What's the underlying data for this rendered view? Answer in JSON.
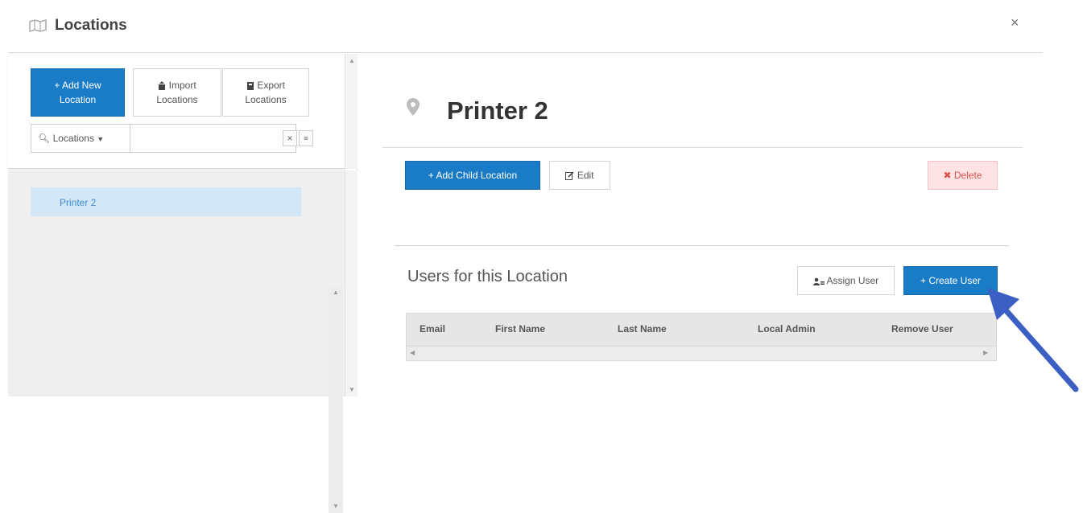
{
  "header": {
    "title": "Locations",
    "close_symbol": "×",
    "icon": "map-icon"
  },
  "left": {
    "add_new_label_1": "+ Add New",
    "add_new_label_2": "Location",
    "import_label_1": "Import",
    "import_label_2": "Locations",
    "export_label_1": "Export",
    "export_label_2": "Locations",
    "search_dropdown": "Locations",
    "search_value": "",
    "tree": [
      {
        "label": "Printer 2",
        "selected": true
      }
    ]
  },
  "detail": {
    "title": "Printer 2",
    "add_child_label": "+ Add Child Location",
    "edit_label": "Edit",
    "delete_label": "Delete",
    "users_title": "Users for this Location",
    "assign_user_label": "Assign User",
    "create_user_label": "+ Create User",
    "table_columns": [
      "Email",
      "First Name",
      "Last Name",
      "Local Admin",
      "Remove User"
    ]
  },
  "colors": {
    "primary": "#1a7bc6",
    "selected_row_bg": "#d3e7f6",
    "selected_row_text": "#3f8ad0",
    "delete_bg": "#fde3e3",
    "delete_text": "#d9534f",
    "annotation_arrow": "#3b5fc2"
  }
}
